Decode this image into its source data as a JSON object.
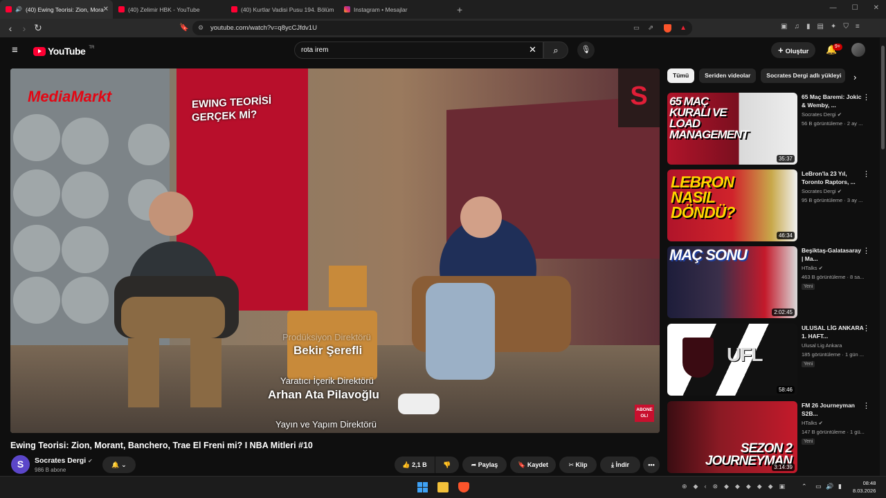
{
  "browser": {
    "tabs": [
      {
        "label": "(40) Ewing Teorisi: Zion, Mora",
        "favicon": "youtube-icon",
        "active": true
      },
      {
        "label": "(40) Zelimir HBK - YouTube",
        "favicon": "youtube-icon",
        "active": false
      },
      {
        "label": "(40) Kurtlar Vadisi Pusu 194. Bölüm",
        "favicon": "youtube-icon",
        "active": false
      },
      {
        "label": "Instagram • Mesajlar",
        "favicon": "instagram-icon",
        "active": false
      }
    ],
    "url": "youtube.com/watch?v=q8ycCJfdv1U"
  },
  "youtube": {
    "logo_text": "YouTube",
    "logo_region": "TR",
    "search_value": "rota irem",
    "create_label": "Oluştur",
    "notification_count": "9+"
  },
  "video": {
    "title": "Ewing Teorisi: Zion, Morant, Banchero, Trae El Freni mi? I NBA Mitleri #10",
    "channel": "Socrates Dergi",
    "channel_initial": "S",
    "subscribers": "986 B abone",
    "likes": "2,1 B",
    "share_label": "Paylaş",
    "save_label": "Kaydet",
    "clip_label": "Klip",
    "download_label": "İndir",
    "overlay": {
      "poster_title": "EWING TEORİSİ GERÇEK Mİ?",
      "brand": "MediaMarkt",
      "credit1_role": "Prodüksiyon Direktörü",
      "credit1_name": "Bekir Şerefli",
      "credit2_role": "Yaratıcı İçerik Direktörü",
      "credit2_name": "Arhan Ata Pilavoğlu",
      "credit3_role": "Yayın ve Yapım Direktörü",
      "subscribe_badge": "ABONE OL!",
      "corner_logo": "S"
    }
  },
  "chips": [
    "Tümü",
    "Seriden videolar",
    "Socrates Dergi adlı yükleyi"
  ],
  "recommendations": [
    {
      "title": "65 Maç Baremi: Jokic & Wemby, ...",
      "channel": "Socrates Dergi",
      "meta": "56 B görüntüleme · 2 ay ...",
      "duration": "35:37",
      "thumb_text": "65 MAÇ KURALI VE LOAD MANAGEMENT",
      "new": ""
    },
    {
      "title": "LeBron'la 23 Yıl, Toronto Raptors, ...",
      "channel": "Socrates Dergi",
      "meta": "95 B görüntüleme · 3 ay ...",
      "duration": "46:34",
      "thumb_text": "LEBRON NASIL DÖNDÜ?",
      "new": ""
    },
    {
      "title": "Beşiktaş-Galatasaray | Ma...",
      "channel": "HTalks",
      "meta": "463 B görüntüleme · 8 sa...",
      "duration": "2:02:45",
      "thumb_text": "MAÇ SONU",
      "new": "Yeni"
    },
    {
      "title": "ULUSAL LİG ANKARA 1. HAFT...",
      "channel": "Ulusal Lig Ankara",
      "meta": "185 görüntüleme · 1 gün ...",
      "duration": "58:46",
      "thumb_text": "UFL",
      "new": "Yeni"
    },
    {
      "title": "FM 26 Journeyman S2B...",
      "channel": "HTalks",
      "meta": "147 B görüntüleme · 1 gü...",
      "duration": "3:14:39",
      "thumb_text": "SEZON 2 JOURNEYMAN",
      "new": "Yeni"
    }
  ],
  "taskbar": {
    "time": "08:48",
    "date": "8.03.2026"
  }
}
